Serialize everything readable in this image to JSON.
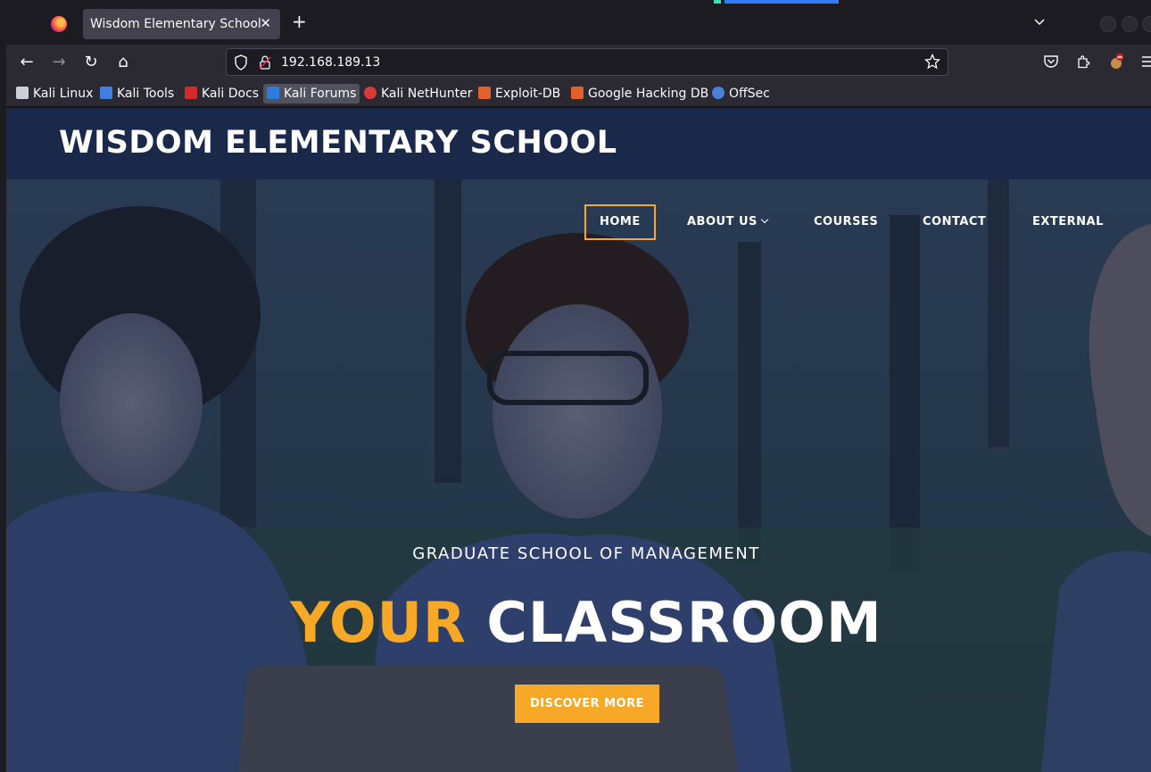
{
  "browser": {
    "tab": {
      "title": "Wisdom Elementary School",
      "close_glyph": "✕"
    },
    "new_tab_glyph": "+",
    "url": "192.168.189.13",
    "nav": {
      "back": "←",
      "forward": "→",
      "reload": "↻",
      "home": "⌂"
    },
    "bookmarks": [
      {
        "label": "Kali Linux",
        "icon": "kali-dragon-icon",
        "color": "#d0d0d0"
      },
      {
        "label": "Kali Tools",
        "icon": "kali-tools-icon",
        "color": "#3f7fe0"
      },
      {
        "label": "Kali Docs",
        "icon": "kali-docs-icon",
        "color": "#d42a2a"
      },
      {
        "label": "Kali Forums",
        "icon": "kali-forums-icon",
        "color": "#2e7bdc"
      },
      {
        "label": "Kali NetHunter",
        "icon": "nethunter-icon",
        "color": "#d83a3a"
      },
      {
        "label": "Exploit-DB",
        "icon": "exploit-db-icon",
        "color": "#e0612a"
      },
      {
        "label": "Google Hacking DB",
        "icon": "ghdb-icon",
        "color": "#e0612a"
      },
      {
        "label": "OffSec",
        "icon": "offsec-icon",
        "color": "#4a7fd8"
      }
    ]
  },
  "site": {
    "title": "WISDOM ELEMENTARY SCHOOL",
    "nav": [
      {
        "label": "HOME",
        "active": true
      },
      {
        "label": "ABOUT US",
        "dropdown": true
      },
      {
        "label": "COURSES"
      },
      {
        "label": "CONTACT"
      },
      {
        "label": "EXTERNAL"
      }
    ],
    "hero": {
      "subtitle": "GRADUATE SCHOOL OF MANAGEMENT",
      "headline_accent": "YOUR",
      "headline_rest": " CLASSROOM",
      "cta_label": "DISCOVER MORE"
    }
  },
  "colors": {
    "accent": "#f6a826",
    "header_band": "#182648",
    "browser_bg": "#1c1b22"
  }
}
